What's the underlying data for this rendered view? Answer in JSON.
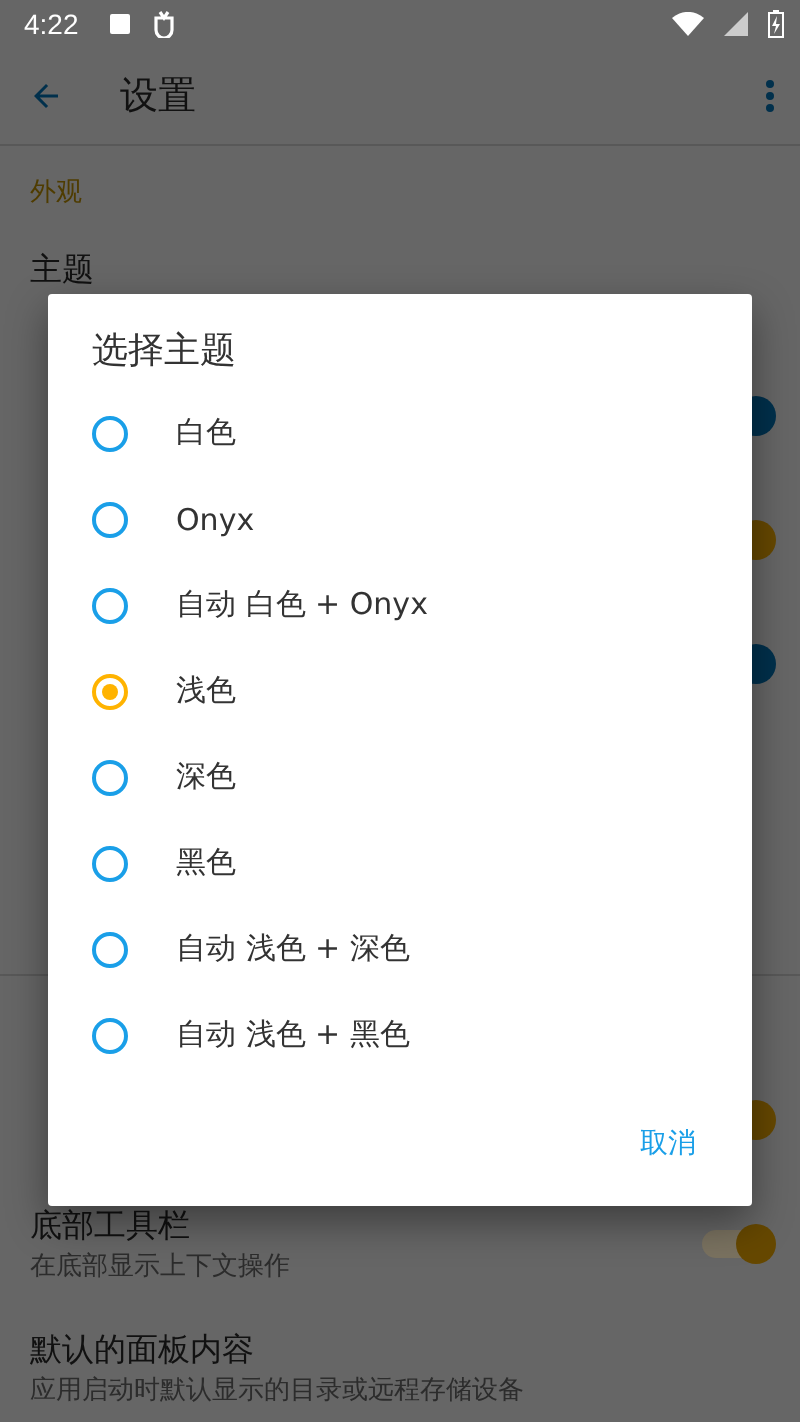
{
  "status_bar": {
    "time": "4:22"
  },
  "app_bar": {
    "title": "设置"
  },
  "sections": [
    {
      "header": "外观",
      "rows": [
        {
          "title": "主题"
        },
        {
          "switch": {
            "on": true,
            "color": "#01304c"
          }
        },
        {
          "switch": {
            "on": true,
            "color": "#664800"
          }
        },
        {
          "switch": {
            "on": true,
            "color": "#01304c"
          }
        }
      ]
    },
    {
      "rows": [
        {
          "switch": {
            "on": true,
            "color": "#664800"
          }
        },
        {
          "title": "底部工具栏",
          "subtitle": "在底部显示上下文操作",
          "switch": {
            "on": true,
            "color": "#664800"
          }
        },
        {
          "title": "默认的面板内容",
          "subtitle": "应用启动时默认显示的目录或远程存储设备"
        }
      ]
    }
  ],
  "dialog": {
    "title": "选择主题",
    "options": [
      {
        "label": "白色",
        "selected": false
      },
      {
        "label": "Onyx",
        "selected": false
      },
      {
        "label": "自动 白色 + Onyx",
        "selected": false
      },
      {
        "label": "浅色",
        "selected": true
      },
      {
        "label": "深色",
        "selected": false
      },
      {
        "label": "黑色",
        "selected": false
      },
      {
        "label": "自动 浅色 + 深色",
        "selected": false
      },
      {
        "label": "自动 浅色 + 黑色",
        "selected": false
      }
    ],
    "buttons": [
      "取消"
    ]
  }
}
